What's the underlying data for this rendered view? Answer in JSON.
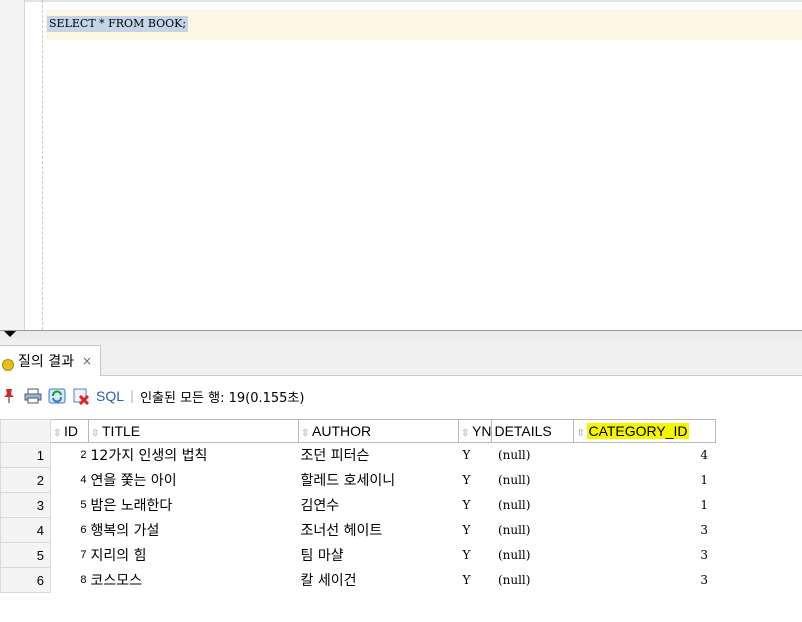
{
  "editor": {
    "sql": "SELECT * FROM BOOK;"
  },
  "results_tab": {
    "label": "질의 결과",
    "close": "×"
  },
  "toolbar": {
    "sql_label": "SQL",
    "separator": "|",
    "status": "인출된 모든 행: 19(0.155초)",
    "icons": [
      "pin-icon",
      "print-icon",
      "refresh-icon",
      "clear-icon"
    ]
  },
  "grid": {
    "columns": [
      "ID",
      "TITLE",
      "AUTHOR",
      "YN",
      "DETAILS",
      "CATEGORY_ID"
    ],
    "highlighted_column": "CATEGORY_ID",
    "rows": [
      {
        "rownum": "1",
        "id": "2",
        "title": "12가지 인생의 법칙",
        "author": "조던 피터슨",
        "yn": "Y",
        "details": "(null)",
        "category_id": "4"
      },
      {
        "rownum": "2",
        "id": "4",
        "title": "연을 쫓는 아이",
        "author": "할레드 호세이니",
        "yn": "Y",
        "details": "(null)",
        "category_id": "1"
      },
      {
        "rownum": "3",
        "id": "5",
        "title": "밤은 노래한다",
        "author": "김연수",
        "yn": "Y",
        "details": "(null)",
        "category_id": "1"
      },
      {
        "rownum": "4",
        "id": "6",
        "title": "행복의 가설",
        "author": "조너선 헤이트",
        "yn": "Y",
        "details": "(null)",
        "category_id": "3"
      },
      {
        "rownum": "5",
        "id": "7",
        "title": "지리의 힘",
        "author": "팀 마샬",
        "yn": "Y",
        "details": "(null)",
        "category_id": "3"
      },
      {
        "rownum": "6",
        "id": "8",
        "title": "코스모스",
        "author": "칼 세이건",
        "yn": "Y",
        "details": "(null)",
        "category_id": "3"
      }
    ]
  },
  "colors": {
    "selection": "#c5d5e7",
    "current_line": "#fdf6e3",
    "header_highlight": "#f5f500",
    "sql_link": "#2a5bb5"
  }
}
